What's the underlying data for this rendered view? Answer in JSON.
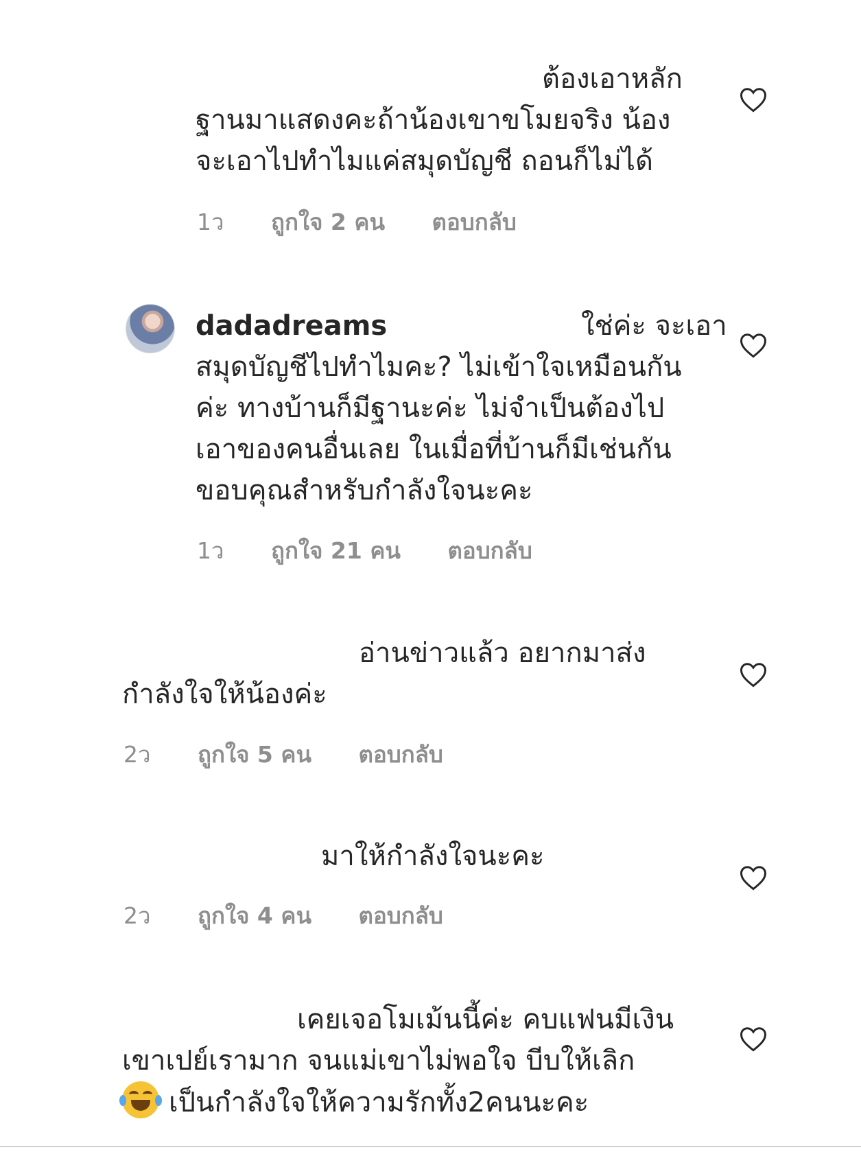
{
  "comments": [
    {
      "username": "",
      "text_lines": [
        "ต้องเอาหลัก",
        "ฐานมาแสดงคะถ้าน้องเขาขโมยจริง น้อง",
        "จะเอาไปทำไมแค่สมุดบัญชี ถอนก็ไม่ได้"
      ],
      "time": "1ว",
      "likes": "ถูกใจ 2 คน",
      "reply": "ตอบกลับ"
    },
    {
      "username": "dadadreams",
      "text_lines": [
        "ใช่ค่ะ จะเอา",
        "สมุดบัญชีไปทำไมคะ? ไม่เข้าใจเหมือนกัน",
        "ค่ะ ทางบ้านก็มีฐานะค่ะ ไม่จำเป็นต้องไป",
        "เอาของคนอื่นเลย ในเมื่อที่บ้านก็มีเช่นกัน",
        "ขอบคุณสำหรับกำลังใจนะคะ"
      ],
      "time": "1ว",
      "likes": "ถูกใจ 21 คน",
      "reply": "ตอบกลับ"
    },
    {
      "username": "",
      "text_lines": [
        "อ่านข่าวแล้ว อยากมาส่ง",
        "กำลังใจให้น้องค่ะ"
      ],
      "time": "2ว",
      "likes": "ถูกใจ 5 คน",
      "reply": "ตอบกลับ"
    },
    {
      "username": "",
      "text_lines": [
        "มาให้กำลังใจนะคะ"
      ],
      "time": "2ว",
      "likes": "ถูกใจ 4 คน",
      "reply": "ตอบกลับ"
    },
    {
      "username": "",
      "text_lines": [
        "เคยเจอโมเม้นนี้ค่ะ คบแฟนมีเงิน",
        "เขาเปย์เรามาก จนแม่เขาไม่พอใจ บีบให้เลิก",
        "เป็นกำลังใจให้ความรักทั้ง2คนนะคะ"
      ],
      "emoji": "face-with-tears-of-joy",
      "time": "",
      "likes": "",
      "reply": ""
    }
  ],
  "icons": {
    "like": "heart-outline-icon",
    "avatar": "user-avatar"
  },
  "colors": {
    "text": "#262626",
    "meta": "#8e8e8e",
    "background": "#ffffff"
  }
}
